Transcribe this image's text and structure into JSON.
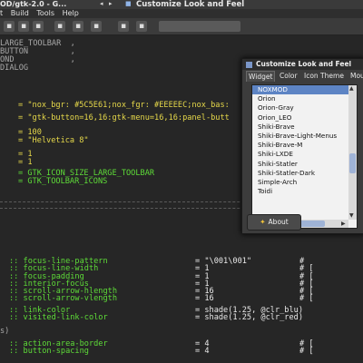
{
  "editor": {
    "window_title": "OD/gtk-2.0 - G...",
    "menu": [
      "t",
      "Build",
      "Tools",
      "Help"
    ],
    "lines_top": [
      "LARGE_TOOLBAR  ,",
      "BUTTON         ,",
      "OND            ,",
      "DIALOG"
    ],
    "code": [
      "= \"nox_bgr: #5C5E61;nox_fgr: #EEEEEC;nox_bas:",
      "= \"gtk-button=16,16:gtk-menu=16,16:panel-butt",
      "= 100",
      "= \"Helvetica 8\"",
      "= 1",
      "= 1",
      "= GTK_ICON_SIZE_LARGE_TOOLBAR",
      "= GTK_TOOLBAR_ICONS"
    ],
    "props": [
      [
        ":: focus-line-pattern",
        "= \"\\001\\001\"",
        "#"
      ],
      [
        ":: focus-line-width",
        "= 1",
        "# ["
      ],
      [
        ":: focus-padding",
        "= 1",
        "# ["
      ],
      [
        ":: interior-focus",
        "= 1",
        "# ["
      ],
      [
        ":: scroll-arrow-hlength",
        "= 16",
        "# ["
      ],
      [
        ":: scroll-arrow-vlength",
        "= 16",
        "# ["
      ],
      [
        ":: link-color",
        "= shade(1.25, @clr_blu)",
        ""
      ],
      [
        ":: visited-link-color",
        "= shade(1.25, @clr_red)",
        ""
      ],
      [
        ":: action-area-border",
        "= 4",
        "# ["
      ],
      [
        ":: button-spacing",
        "= 4",
        "# ["
      ]
    ],
    "stray": [
      "s)"
    ]
  },
  "dialog": {
    "title": "Customize Look and Feel",
    "tabs": [
      "Widget",
      "Color",
      "Icon Theme",
      "Mou"
    ],
    "themes": [
      "NOXMOD",
      "Orion",
      "Orion-Gray",
      "Orion_LEO",
      "Shiki-Brave",
      "Shiki-Brave-Light-Menus",
      "Shiki-Brave-M",
      "Shiki-LXDE",
      "Shiki-Statler",
      "Shiki-Statler-Dark",
      "Simple-Arch",
      "Toidi"
    ],
    "selected": "NOXMOD",
    "about_label": "About"
  },
  "colors": {
    "code_green": "#5edc38",
    "code_yellow": "#e6d84a",
    "selection": "#5d84c4"
  }
}
